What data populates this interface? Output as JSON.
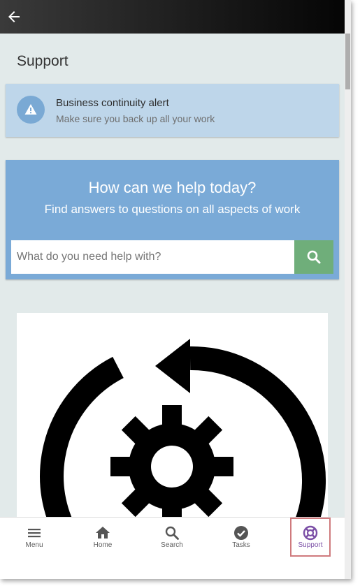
{
  "header": {
    "back_icon": "arrow-left-icon"
  },
  "page": {
    "title": "Support"
  },
  "alert": {
    "icon": "warning-icon",
    "title": "Business continuity alert",
    "subtitle": "Make sure you back up all your work"
  },
  "help": {
    "title": "How can we help today?",
    "subtitle": "Find answers to questions on all aspects of work",
    "search_placeholder": "What do you need help with?",
    "search_value": "",
    "search_icon": "search-icon"
  },
  "image": {
    "icon": "gear-refresh-icon"
  },
  "bottom_nav": {
    "items": [
      {
        "label": "Menu",
        "icon": "menu-icon",
        "active": false
      },
      {
        "label": "Home",
        "icon": "home-icon",
        "active": false
      },
      {
        "label": "Search",
        "icon": "search-icon",
        "active": false
      },
      {
        "label": "Tasks",
        "icon": "check-circle-icon",
        "active": false
      },
      {
        "label": "Support",
        "icon": "lifebuoy-icon",
        "active": true
      }
    ]
  },
  "colors": {
    "alert_bg": "#bed6ea",
    "help_bg": "#7aaad7",
    "search_button": "#6fae7a",
    "active_nav": "#7b4fa6",
    "highlight_border": "#cf7a7d"
  }
}
